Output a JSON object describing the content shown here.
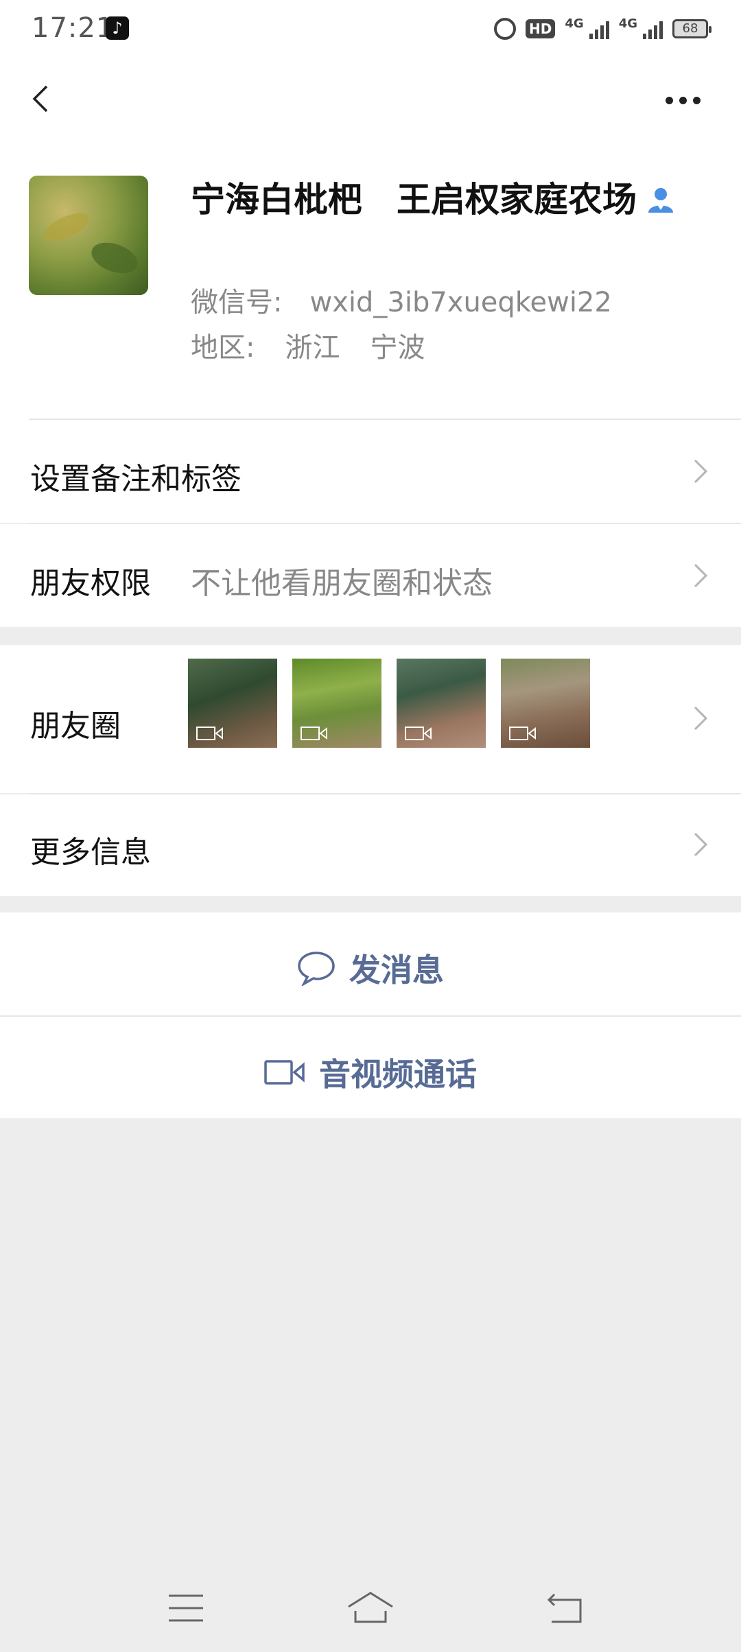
{
  "status_bar": {
    "time": "17:21",
    "hd_label": "HD",
    "sim_label": "4G",
    "sim2_label": "4G",
    "battery": "68",
    "icons": [
      "tiktok-icon",
      "alarm-icon",
      "hd-icon",
      "signal-icon",
      "signal-icon",
      "battery-icon"
    ]
  },
  "nav": {
    "back_icon": "chevron-left-icon",
    "more_icon": "more-dots-icon"
  },
  "profile": {
    "name": "宁海白枇杷　王启权家庭农场",
    "contact_badge_icon": "person-icon",
    "wechat_id_label": "微信号:",
    "wechat_id": "wxid_3ib7xueqkewi22",
    "region_label": "地区:",
    "province": "浙江",
    "city": "宁波"
  },
  "rows": {
    "remark_tags": "设置备注和标签",
    "friend_permission_title": "朋友权限",
    "friend_permission_value": "不让他看朋友圈和状态",
    "moments_title": "朋友圈",
    "more_info": "更多信息"
  },
  "actions": {
    "send_message": "发消息",
    "video_call": "音视频通话"
  },
  "colors": {
    "link": "#576b95",
    "background": "#ededed",
    "badge": "#4a90e2"
  }
}
